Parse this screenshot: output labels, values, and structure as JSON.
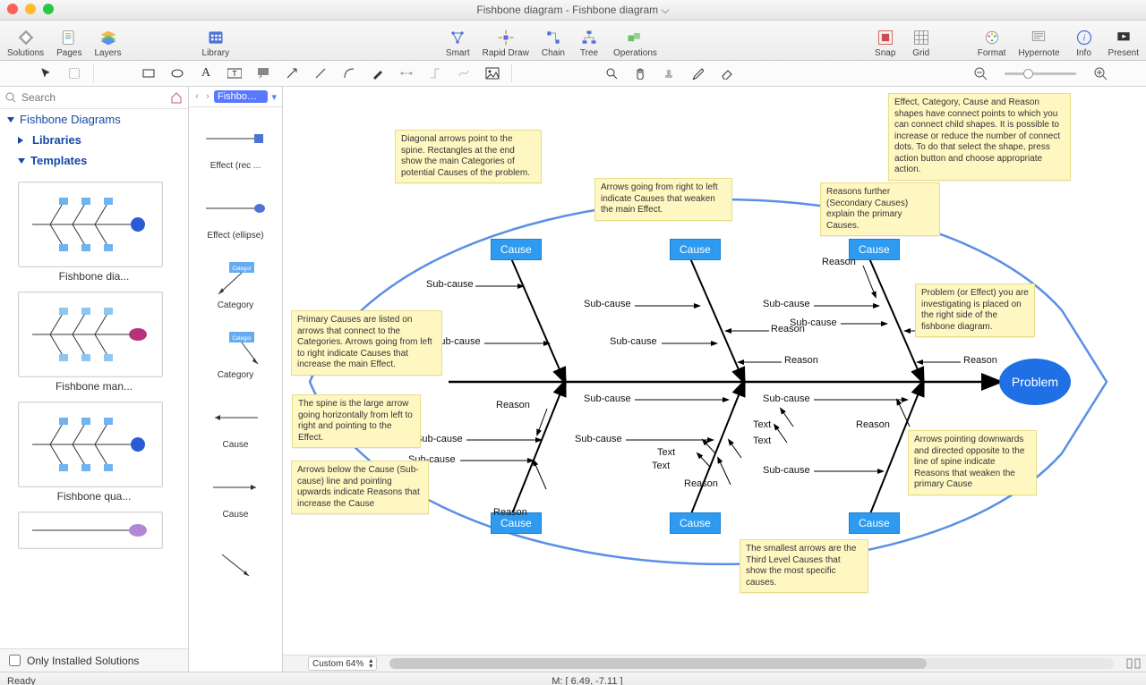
{
  "titlebar": {
    "title": "Fishbone diagram - Fishbone diagram ⌵"
  },
  "traffic": {
    "close": "#ff5f57",
    "min": "#febc2e",
    "max": "#28c840"
  },
  "toolbar": {
    "left": [
      {
        "name": "solutions",
        "label": "Solutions"
      },
      {
        "name": "pages",
        "label": "Pages"
      },
      {
        "name": "layers",
        "label": "Layers"
      }
    ],
    "library": {
      "label": "Library"
    },
    "mid": [
      {
        "name": "smart",
        "label": "Smart"
      },
      {
        "name": "rapid",
        "label": "Rapid Draw"
      },
      {
        "name": "chain",
        "label": "Chain"
      },
      {
        "name": "tree",
        "label": "Tree"
      },
      {
        "name": "ops",
        "label": "Operations"
      }
    ],
    "snapgrid": [
      {
        "name": "snap",
        "label": "Snap"
      },
      {
        "name": "grid",
        "label": "Grid"
      }
    ],
    "right": [
      {
        "name": "format",
        "label": "Format"
      },
      {
        "name": "hypernote",
        "label": "Hypernote"
      },
      {
        "name": "info",
        "label": "Info"
      },
      {
        "name": "present",
        "label": "Present"
      }
    ]
  },
  "zoom": {
    "minus": "−",
    "plus": "+",
    "value": 30
  },
  "sidebar": {
    "search_placeholder": "Search",
    "group": "Fishbone Diagrams",
    "libraries": "Libraries",
    "templates": "Templates",
    "cards": [
      {
        "label": "Fishbone dia...",
        "color": "#2e9bf0",
        "effect": "blue"
      },
      {
        "label": "Fishbone man...",
        "color": "#2e9bf0",
        "effect": "magenta"
      },
      {
        "label": "Fishbone qua...",
        "color": "#2e9bf0",
        "effect": "blue"
      }
    ],
    "only": "Only Installed Solutions"
  },
  "shapelib": {
    "title": "Fishbo…",
    "items": [
      {
        "label": "Effect (rec ..."
      },
      {
        "label": "Effect (ellipse)"
      },
      {
        "label": "Category"
      },
      {
        "label": "Category"
      },
      {
        "label": "Cause"
      },
      {
        "label": "Cause"
      }
    ]
  },
  "diagram": {
    "problem": "Problem",
    "cause": "Cause",
    "labels": {
      "subcause": "Sub-cause",
      "reason": "Reason",
      "text": "Text"
    },
    "notes": {
      "n1": "Diagonal arrows point to the spine. Rectangles at the end show the main Categories of potential Causes of the problem.",
      "n2": "Arrows going from right to left indicate Causes that weaken the main Effect.",
      "n3": "Reasons further (Secondary Causes) explain the primary Causes.",
      "n4": "Effect, Category, Cause and Reason shapes have connect points to which you can connect child shapes. It is possible to increase or reduce the number of connect dots. To do that select the shape, press action button and choose appropriate action.",
      "n5": "Problem (or Effect) you are investigating is placed on the right side of the fishbone diagram.",
      "n6": "Primary Causes are listed on arrows that connect to the Categories. Arrows going from left to right indicate Causes that increase the main Effect.",
      "n7": "The spine is the large arrow going horizontally from left to right and pointing to the Effect.",
      "n8": "Arrows below the Cause (Sub-cause) line and pointing upwards indicate Reasons that increase the Cause",
      "n9": "Arrows pointing downwards and directed opposite to the line of spine indicate Reasons that weaken the primary Cause",
      "n10": "The smallest arrows are the Third Level Causes that show the most specific causes."
    }
  },
  "footer": {
    "zoom": "Custom 64%",
    "coord": "M: [ 6.49, -7.11 ]",
    "ready": "Ready"
  }
}
